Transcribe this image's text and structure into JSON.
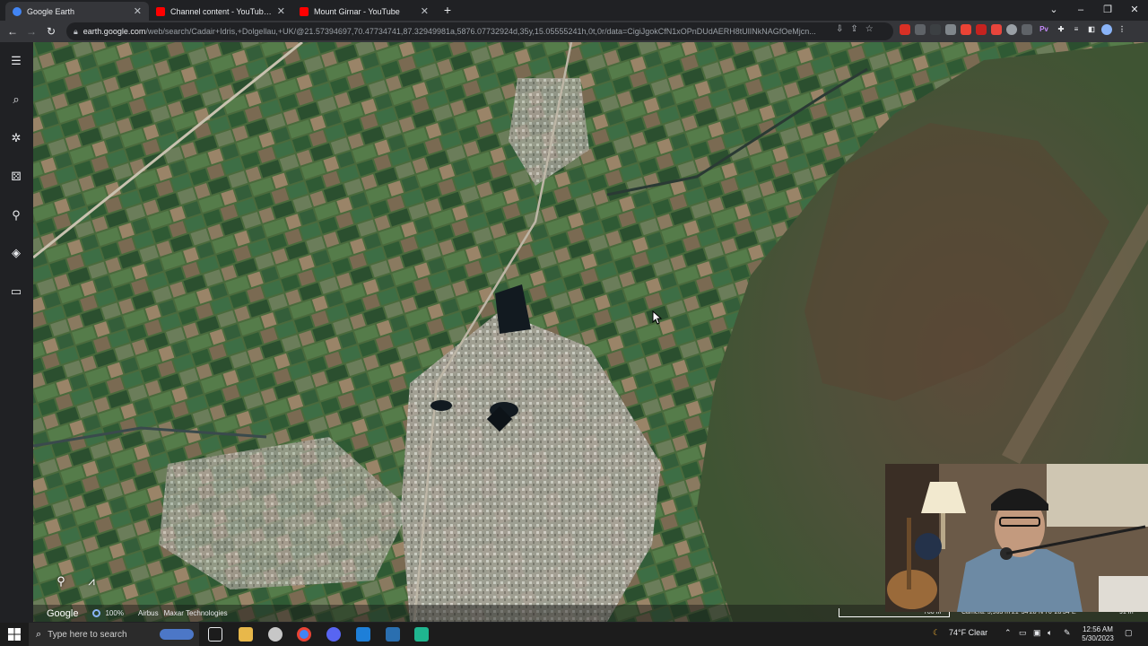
{
  "browser": {
    "tabs": [
      {
        "title": "Google Earth",
        "favicon": "google-earth-icon",
        "color": "#4285f4",
        "active": true
      },
      {
        "title": "Channel content - YouTube Studi",
        "favicon": "youtube-icon",
        "color": "#ff0000",
        "active": false
      },
      {
        "title": "Mount Girnar - YouTube",
        "favicon": "youtube-icon",
        "color": "#ff0000",
        "active": false
      }
    ],
    "new_tab_symbol": "+",
    "url_host": "earth.google.com",
    "url_path": "/web/search/Cadair+Idris,+Dolgellau,+UK/@21.57394697,70.47734741,87.32949981a,5876.07732924d,35y,15.05555241h,0t,0r/data=CigiJgokCfN1xOPnDUdAERH8tUlINkNAGfOeMjcn..."
  },
  "earth": {
    "attribution_brand": "Google",
    "zoom_level": "100%",
    "credits": [
      "Airbus",
      "Maxar Technologies"
    ],
    "scale_label": "700 m",
    "camera": "Camera: 5,963 m   21°34'28\"N 70°28'34\"E",
    "elevation": "91 m"
  },
  "taskbar": {
    "search_placeholder": "Type here to search",
    "weather": "74°F  Clear",
    "time": "12:56 AM",
    "date": "5/30/2023"
  }
}
